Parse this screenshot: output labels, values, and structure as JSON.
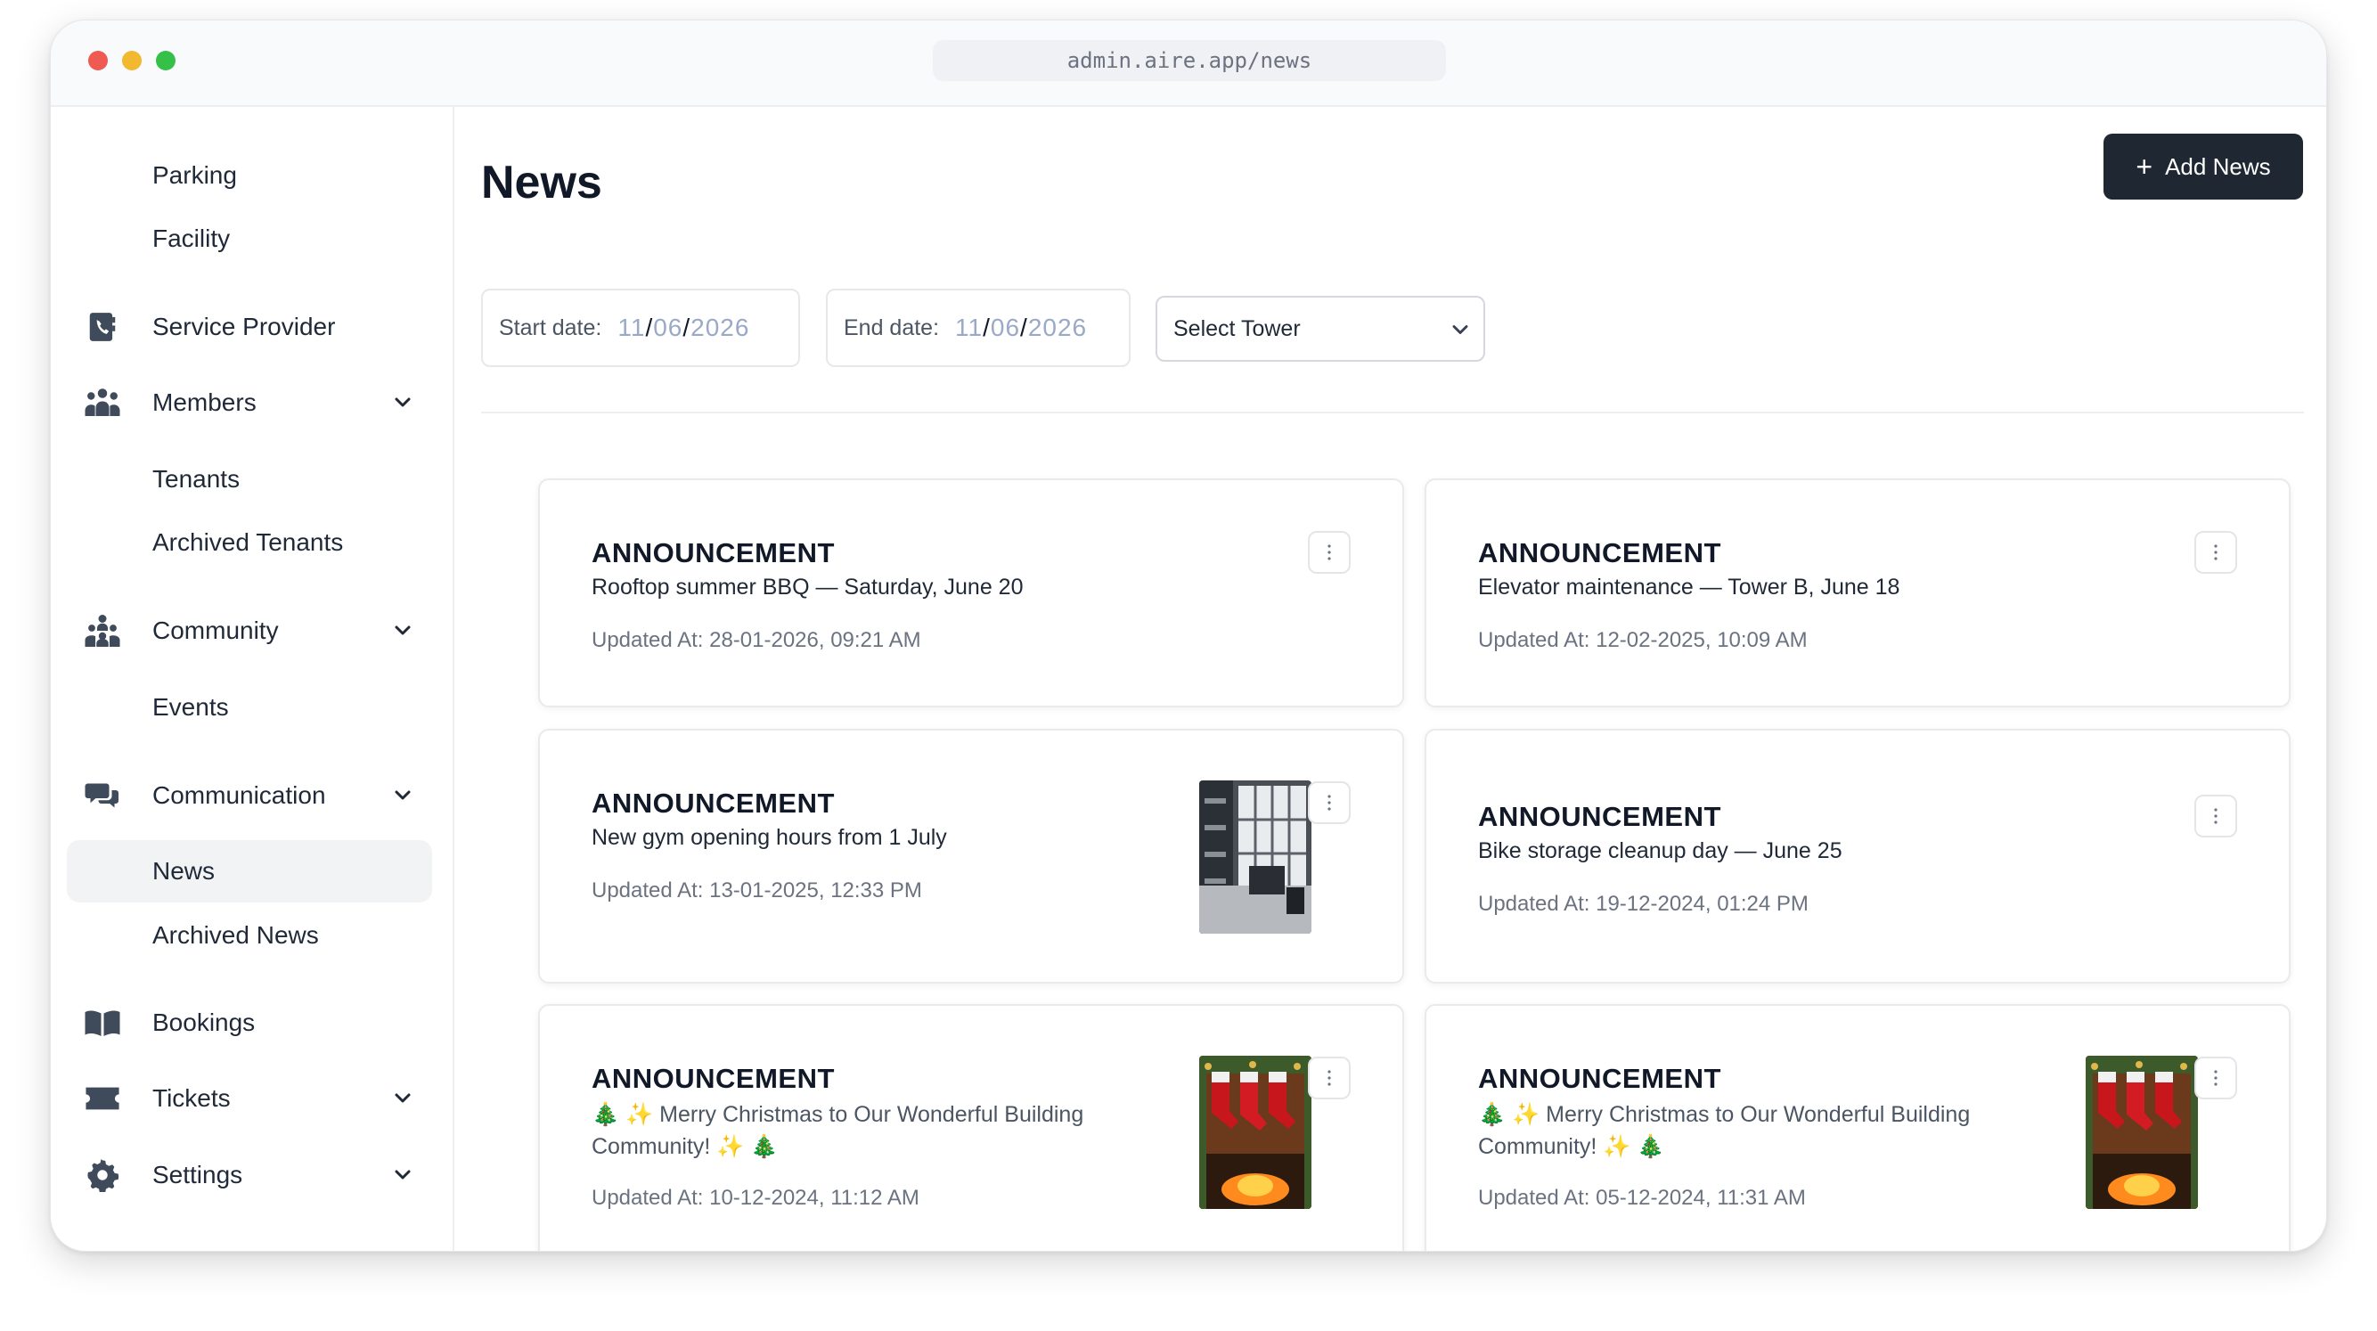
{
  "browser": {
    "url": "admin.aire.app/news"
  },
  "sidebar": {
    "items": [
      {
        "label": "Parking"
      },
      {
        "label": "Facility"
      },
      {
        "label": "Service Provider",
        "icon": "phone-book-icon"
      },
      {
        "label": "Members",
        "icon": "members-icon",
        "expandable": true
      },
      {
        "label": "Tenants"
      },
      {
        "label": "Archived Tenants"
      },
      {
        "label": "Community",
        "icon": "community-icon",
        "expandable": true
      },
      {
        "label": "Events"
      },
      {
        "label": "Communication",
        "icon": "chat-icon",
        "expandable": true
      },
      {
        "label": "News",
        "active": true
      },
      {
        "label": "Archived News"
      },
      {
        "label": "Bookings",
        "icon": "book-icon"
      },
      {
        "label": "Tickets",
        "icon": "ticket-icon",
        "expandable": true
      },
      {
        "label": "Settings",
        "icon": "gear-icon",
        "expandable": true
      }
    ]
  },
  "header": {
    "title": "News",
    "add_button_label": "Add News"
  },
  "filters": {
    "start_label": "Start date:",
    "start_day": "11",
    "start_month": "06",
    "start_year": "2026",
    "end_label": "End date:",
    "end_day": "11",
    "end_month": "06",
    "end_year": "2026",
    "tower_placeholder": "Select Tower"
  },
  "news": [
    {
      "kind": "ANNOUNCEMENT",
      "title": "Rooftop summer BBQ — Saturday, June 20",
      "updated": "Updated At: 28-01-2026, 09:21 AM",
      "thumbnail": null
    },
    {
      "kind": "ANNOUNCEMENT",
      "title": "Elevator maintenance — Tower B, June 18",
      "updated": "Updated At: 12-02-2025, 10:09 AM",
      "thumbnail": null
    },
    {
      "kind": "ANNOUNCEMENT",
      "title": "New gym opening hours from 1 July",
      "updated": "Updated At: 13-01-2025, 12:33 PM",
      "thumbnail": "gym-interior"
    },
    {
      "kind": "ANNOUNCEMENT",
      "title": "Bike storage cleanup day — June 25",
      "updated": "Updated At: 19-12-2024, 01:24 PM",
      "thumbnail": null
    },
    {
      "kind": "ANNOUNCEMENT",
      "title": "🎄 ✨ Merry Christmas to Our Wonderful Building Community! ✨ 🎄",
      "updated": "Updated At: 10-12-2024, 11:12 AM",
      "thumbnail": "christmas-stockings"
    },
    {
      "kind": "ANNOUNCEMENT",
      "title": "🎄 ✨ Merry Christmas to Our Wonderful Building Community! ✨ 🎄",
      "updated": "Updated At: 05-12-2024, 11:31 AM",
      "thumbnail": "christmas-stockings"
    }
  ],
  "colors": {
    "primary_button": "#1e2732",
    "active_nav": "#f2f3f5",
    "date_placeholder": "#9aa9c7"
  }
}
